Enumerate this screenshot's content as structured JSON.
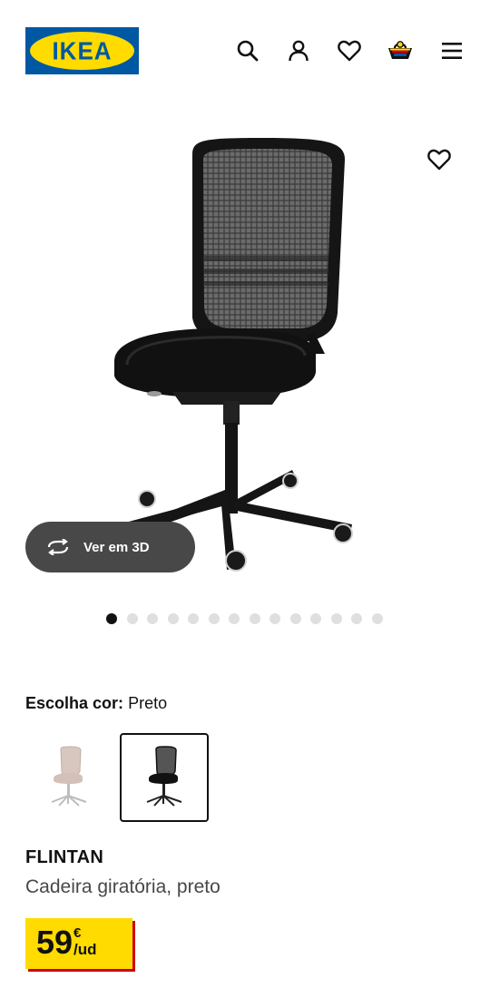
{
  "header": {
    "logo_text": "IKEA",
    "icons": [
      "search-icon",
      "account-icon",
      "favourites-icon",
      "basket-icon",
      "menu-icon"
    ]
  },
  "product_gallery": {
    "view_3d_label": "Ver em 3D",
    "favourite_icon": "heart-icon",
    "slide_count": 14,
    "active_slide": 1
  },
  "color_selection": {
    "label": "Escolha cor:",
    "value": "Preto",
    "options": [
      {
        "name": "beige",
        "selected": false
      },
      {
        "name": "preto",
        "selected": true
      }
    ]
  },
  "product": {
    "name": "FLINTAN",
    "description": "Cadeira giratória, preto",
    "price_integer": "59",
    "price_currency": "€",
    "price_unit": "/ud"
  },
  "colors": {
    "brand_blue": "#0058a3",
    "brand_yellow": "#ffdb00",
    "price_shadow": "#cc0008",
    "button_dark": "#484848"
  }
}
